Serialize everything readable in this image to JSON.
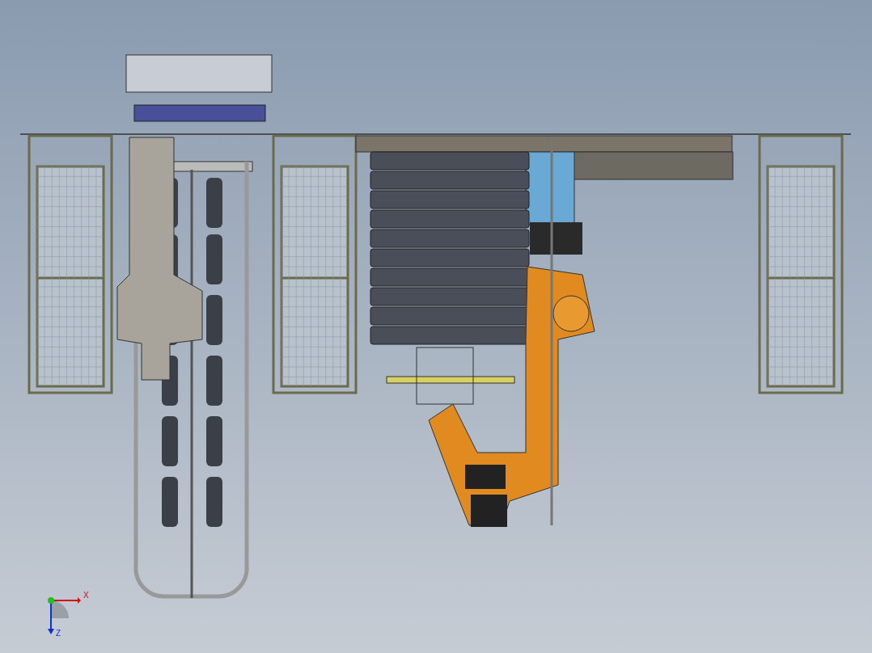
{
  "triad": {
    "x_label": "X",
    "z_label": "Z"
  }
}
